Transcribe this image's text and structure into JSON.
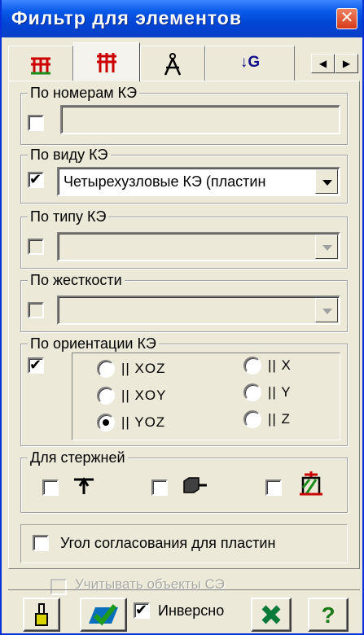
{
  "window": {
    "title": "Фильтр для элементов",
    "close_glyph": "✕"
  },
  "tabs": [
    {
      "name": "tab-mesh-red-green",
      "icon": "grid-icon"
    },
    {
      "name": "tab-mesh-red",
      "icon": "grid-red-icon"
    },
    {
      "name": "tab-compass",
      "icon": "compass-icon"
    },
    {
      "name": "tab-lc",
      "text": "↓G"
    }
  ],
  "tab_scroll": {
    "left": "◀",
    "right": "▶"
  },
  "groups": {
    "by_number": {
      "legend": "По номерам КЭ",
      "checked": false,
      "value": ""
    },
    "by_type": {
      "legend": "По виду КЭ",
      "checked": true,
      "value": "Четырехузловые КЭ (пластин"
    },
    "by_kind": {
      "legend": "По типу КЭ",
      "checked": false,
      "value": ""
    },
    "by_stiffness": {
      "legend": "По жесткости",
      "checked": false,
      "value": ""
    },
    "by_orientation": {
      "legend": "По ориентации КЭ",
      "checked": true,
      "options": [
        {
          "label": "|| XOZ",
          "selected": false
        },
        {
          "label": "|| XOY",
          "selected": false
        },
        {
          "label": "|| YOZ",
          "selected": true
        },
        {
          "label": "|| X",
          "selected": false
        },
        {
          "label": "|| Y",
          "selected": false
        },
        {
          "label": "|| Z",
          "selected": false
        }
      ]
    },
    "for_bars": {
      "legend": "Для стержней"
    }
  },
  "plate_angle": {
    "label": "Угол согласования для пластин",
    "checked": false
  },
  "se_objects": {
    "label": "Учитывать объекты СЭ",
    "checked": false
  },
  "footer": {
    "inverse_label": "Инверсно",
    "inverse_checked": true,
    "help_label": "?"
  },
  "colors": {
    "title_bar": "#0a5ae8",
    "face": "#ece9d8",
    "red_icon": "#cc0000",
    "green_icon": "#1a8c1a"
  }
}
